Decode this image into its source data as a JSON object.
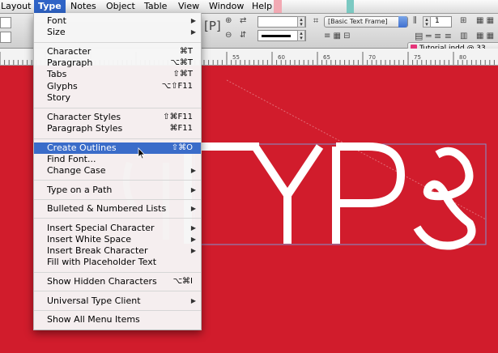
{
  "menubar": {
    "items": [
      {
        "label": "Layout"
      },
      {
        "label": "Type"
      },
      {
        "label": "Notes"
      },
      {
        "label": "Object"
      },
      {
        "label": "Table"
      },
      {
        "label": "View"
      },
      {
        "label": "Window"
      },
      {
        "label": "Help"
      }
    ]
  },
  "control_panel": {
    "frame_style": "[Basic Text Frame]",
    "value_1": "1"
  },
  "ruler": {
    "numbers": [
      "55",
      "60",
      "65",
      "70",
      "75",
      "80"
    ]
  },
  "document_tab": {
    "title": "Tutorial.indd @ 33"
  },
  "canvas": {
    "artwork_text": "TYPE",
    "colors": {
      "background": "#d11c2c",
      "letters": "#ffffff",
      "selection": "#7f94cf"
    }
  },
  "type_menu": {
    "items": [
      {
        "label": "Font",
        "shortcut": "",
        "submenu": true
      },
      {
        "label": "Size",
        "shortcut": "",
        "submenu": true
      },
      {
        "label": "Character",
        "shortcut": "⌘T",
        "submenu": false
      },
      {
        "label": "Paragraph",
        "shortcut": "⌥⌘T",
        "submenu": false
      },
      {
        "label": "Tabs",
        "shortcut": "⇧⌘T",
        "submenu": false
      },
      {
        "label": "Glyphs",
        "shortcut": "⌥⇧F11",
        "submenu": false
      },
      {
        "label": "Story",
        "shortcut": "",
        "submenu": false
      },
      {
        "label": "Character Styles",
        "shortcut": "⇧⌘F11",
        "submenu": false
      },
      {
        "label": "Paragraph Styles",
        "shortcut": "⌘F11",
        "submenu": false
      },
      {
        "label": "Create Outlines",
        "shortcut": "⇧⌘O",
        "submenu": false
      },
      {
        "label": "Find Font...",
        "shortcut": "",
        "submenu": false
      },
      {
        "label": "Change Case",
        "shortcut": "",
        "submenu": true
      },
      {
        "label": "Type on a Path",
        "shortcut": "",
        "submenu": true
      },
      {
        "label": "Bulleted & Numbered Lists",
        "shortcut": "",
        "submenu": true
      },
      {
        "label": "Insert Special Character",
        "shortcut": "",
        "submenu": true
      },
      {
        "label": "Insert White Space",
        "shortcut": "",
        "submenu": true
      },
      {
        "label": "Insert Break Character",
        "shortcut": "",
        "submenu": true
      },
      {
        "label": "Fill with Placeholder Text",
        "shortcut": "",
        "submenu": false
      },
      {
        "label": "Show Hidden Characters",
        "shortcut": "⌥⌘I",
        "submenu": false
      },
      {
        "label": "Universal Type Client",
        "shortcut": "",
        "submenu": true
      },
      {
        "label": "Show All Menu Items",
        "shortcut": "",
        "submenu": false
      }
    ],
    "highlighted": "Create Outlines"
  }
}
